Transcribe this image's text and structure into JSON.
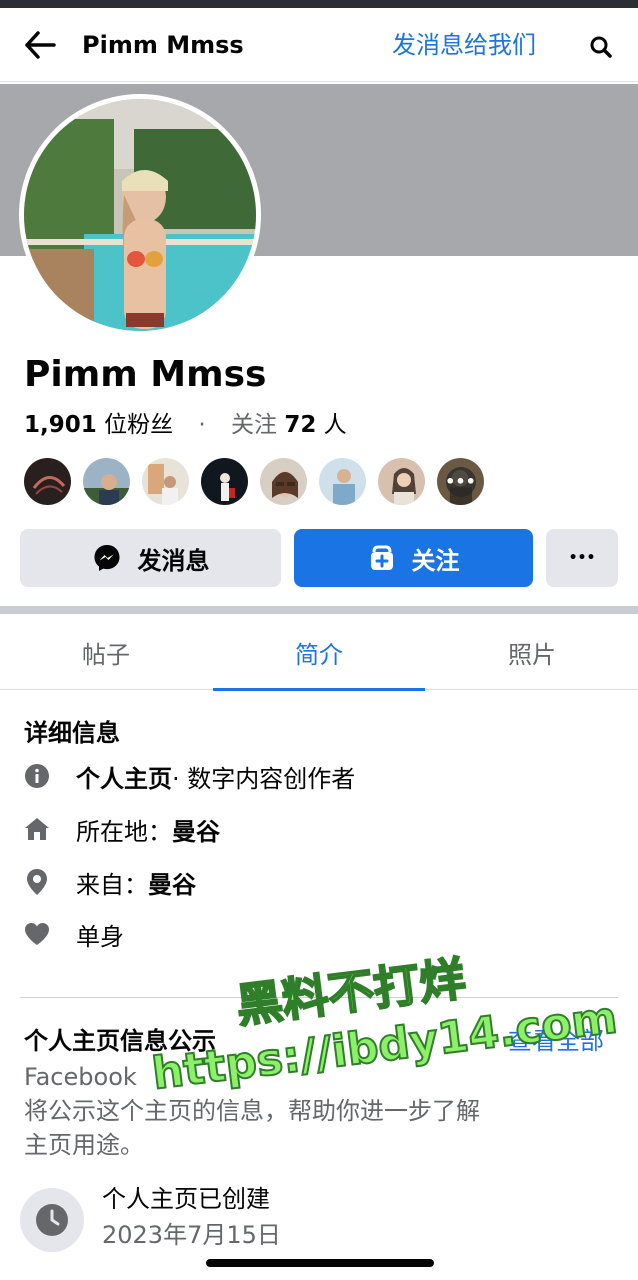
{
  "header": {
    "title": "Pimm Mmss",
    "message_link": "发消息给我们"
  },
  "profile": {
    "name": "Pimm Mmss",
    "followers_count": "1,901",
    "followers_label": "位粉丝",
    "separator": "·",
    "following_label": "关注",
    "following_count": "72",
    "following_unit": "人",
    "friend_avatars": [
      "friend-avatar-1",
      "friend-avatar-2",
      "friend-avatar-3",
      "friend-avatar-4",
      "friend-avatar-5",
      "friend-avatar-6",
      "friend-avatar-7",
      "friend-avatar-more"
    ],
    "more_dots": "•••"
  },
  "actions": {
    "message_button": "发消息",
    "follow_button": "关注",
    "more_button": "•••"
  },
  "tabs": [
    {
      "label": "帖子",
      "active": false
    },
    {
      "label": "简介",
      "active": true
    },
    {
      "label": "照片",
      "active": false
    }
  ],
  "details": {
    "title": "详细信息",
    "page_type_bold": "个人主页",
    "page_type_rest": " · 数字内容创作者",
    "lives_in_label": "所在地：",
    "lives_in_value": "曼谷",
    "from_label": "来自：",
    "from_value": "曼谷",
    "relationship": "单身"
  },
  "transparency": {
    "title": "个人主页信息公示",
    "see_all": "查看全部",
    "source": "Facebook",
    "description": "将公示这个主页的信息，帮助你进一步了解主页用途。",
    "created_label": "个人主页已创建",
    "created_date": "2023年7月15日"
  },
  "watermark": {
    "line1": "黑料不打烊",
    "line2": "https://ibdy14.com"
  },
  "colors": {
    "accent": "#1b74e4",
    "muted_text": "#65676b",
    "button_gray": "#e4e6eb",
    "cover": "#a6a8ab"
  },
  "icons": {
    "back": "arrow-left-icon",
    "search": "search-icon",
    "messenger": "messenger-icon",
    "follow": "follow-add-icon",
    "info": "info-icon",
    "home": "home-icon",
    "location": "location-pin-icon",
    "heart": "heart-icon",
    "clock": "clock-icon"
  }
}
